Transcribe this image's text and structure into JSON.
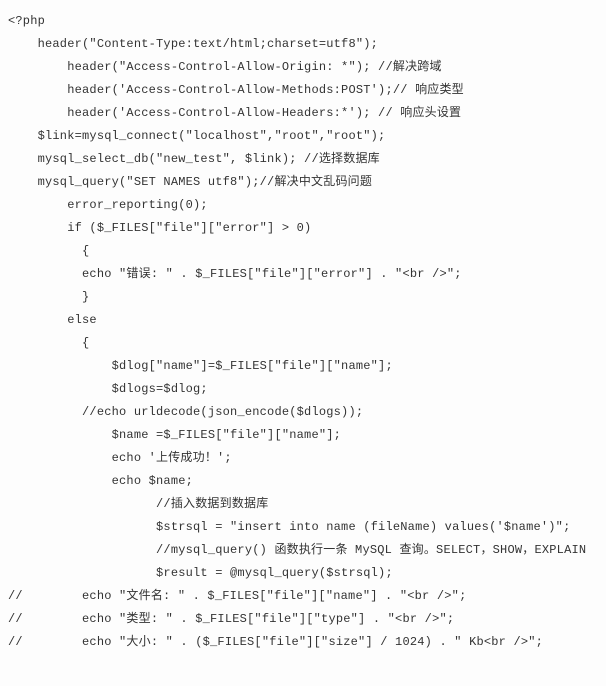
{
  "code": {
    "lines": [
      "<?php",
      "    header(\"Content-Type:text/html;charset=utf8\");",
      "        header(\"Access-Control-Allow-Origin: *\"); //解决跨域",
      "        header('Access-Control-Allow-Methods:POST');// 响应类型",
      "        header('Access-Control-Allow-Headers:*'); // 响应头设置",
      "    $link=mysql_connect(\"localhost\",\"root\",\"root\");",
      "    mysql_select_db(\"new_test\", $link); //选择数据库",
      "    mysql_query(\"SET NAMES utf8\");//解决中文乱码问题",
      "        error_reporting(0);",
      "        if ($_FILES[\"file\"][\"error\"] > 0)",
      "          {",
      "          echo \"错误: \" . $_FILES[\"file\"][\"error\"] . \"<br />\";",
      "          }",
      "        else",
      "          {",
      "              $dlog[\"name\"]=$_FILES[\"file\"][\"name\"];",
      "              $dlogs=$dlog;",
      "          //echo urldecode(json_encode($dlogs));",
      "              $name =$_FILES[\"file\"][\"name\"];",
      "              echo '上传成功！';",
      "              echo $name;",
      "                    //插入数据到数据库",
      "                    $strsql = \"insert into name (fileName) values('$name')\";",
      "                    //mysql_query() 函数执行一条 MySQL 查询。SELECT，SHOW，EXPLAIN",
      "                    $result = @mysql_query($strsql);",
      "//        echo \"文件名: \" . $_FILES[\"file\"][\"name\"] . \"<br />\";",
      "//        echo \"类型: \" . $_FILES[\"file\"][\"type\"] . \"<br />\";",
      "//        echo \"大小: \" . ($_FILES[\"file\"][\"size\"] / 1024) . \" Kb<br />\";"
    ]
  }
}
